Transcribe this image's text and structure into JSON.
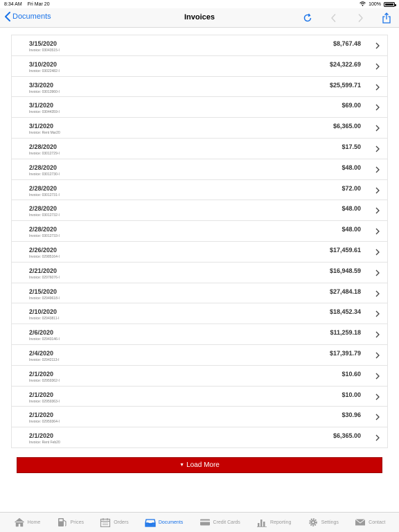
{
  "status_bar": {
    "time": "8:34 AM",
    "date": "Fri Mar 20",
    "battery": "100%"
  },
  "nav": {
    "back_label": "Documents",
    "title": "Invoices",
    "icons": [
      "refresh-icon",
      "chevron-left-icon",
      "chevron-right-icon",
      "share-icon"
    ]
  },
  "invoices": [
    {
      "date": "3/15/2020",
      "invoice": "Invoice: 03043515-I",
      "amount": "$8,767.48"
    },
    {
      "date": "3/10/2020",
      "invoice": "Invoice: 03022482-I",
      "amount": "$24,322.69"
    },
    {
      "date": "3/3/2020",
      "invoice": "Invoice: 03013960-I",
      "amount": "$25,599.71"
    },
    {
      "date": "3/1/2020",
      "invoice": "Invoice: 03044359-I",
      "amount": "$69.00"
    },
    {
      "date": "3/1/2020",
      "invoice": "Invoice: Rent Mar20",
      "amount": "$6,365.00"
    },
    {
      "date": "2/28/2020",
      "invoice": "Invoice: 03012729-I",
      "amount": "$17.50"
    },
    {
      "date": "2/28/2020",
      "invoice": "Invoice: 03012730-I",
      "amount": "$48.00"
    },
    {
      "date": "2/28/2020",
      "invoice": "Invoice: 03012731-I",
      "amount": "$72.00"
    },
    {
      "date": "2/28/2020",
      "invoice": "Invoice: 03012732-I",
      "amount": "$48.00"
    },
    {
      "date": "2/28/2020",
      "invoice": "Invoice: 03012733-I",
      "amount": "$48.00"
    },
    {
      "date": "2/26/2020",
      "invoice": "Invoice: 02985164-I",
      "amount": "$17,459.61"
    },
    {
      "date": "2/21/2020",
      "invoice": "Invoice: 02976076-I",
      "amount": "$16,948.59"
    },
    {
      "date": "2/15/2020",
      "invoice": "Invoice: 02949618-I",
      "amount": "$27,484.18"
    },
    {
      "date": "2/10/2020",
      "invoice": "Invoice: 02943811-I",
      "amount": "$18,452.34"
    },
    {
      "date": "2/6/2020",
      "invoice": "Invoice: 02943146-I",
      "amount": "$11,259.18"
    },
    {
      "date": "2/4/2020",
      "invoice": "Invoice: 02942113-I",
      "amount": "$17,391.79"
    },
    {
      "date": "2/1/2020",
      "invoice": "Invoice: 02959362-I",
      "amount": "$10.60"
    },
    {
      "date": "2/1/2020",
      "invoice": "Invoice: 02959363-I",
      "amount": "$10.00"
    },
    {
      "date": "2/1/2020",
      "invoice": "Invoice: 02959364-I",
      "amount": "$30.96"
    },
    {
      "date": "2/1/2020",
      "invoice": "Invoice: Rent Feb20",
      "amount": "$6,365.00"
    }
  ],
  "load_more_label": "Load More",
  "tabs": [
    {
      "label": "Home",
      "icon": "home-icon",
      "active": false
    },
    {
      "label": "Prices",
      "icon": "fuel-pump-icon",
      "active": false
    },
    {
      "label": "Orders",
      "icon": "calendar-icon",
      "active": false
    },
    {
      "label": "Documents",
      "icon": "inbox-icon",
      "active": true
    },
    {
      "label": "Credit Cards",
      "icon": "credit-card-icon",
      "active": false
    },
    {
      "label": "Reporting",
      "icon": "bar-chart-icon",
      "active": false
    },
    {
      "label": "Settings",
      "icon": "gear-icon",
      "active": false
    },
    {
      "label": "Contact",
      "icon": "envelope-icon",
      "active": false
    }
  ],
  "colors": {
    "accent": "#1a73e8",
    "load_more_bg": "#c40000",
    "tab_inactive": "#9a9a9a"
  }
}
